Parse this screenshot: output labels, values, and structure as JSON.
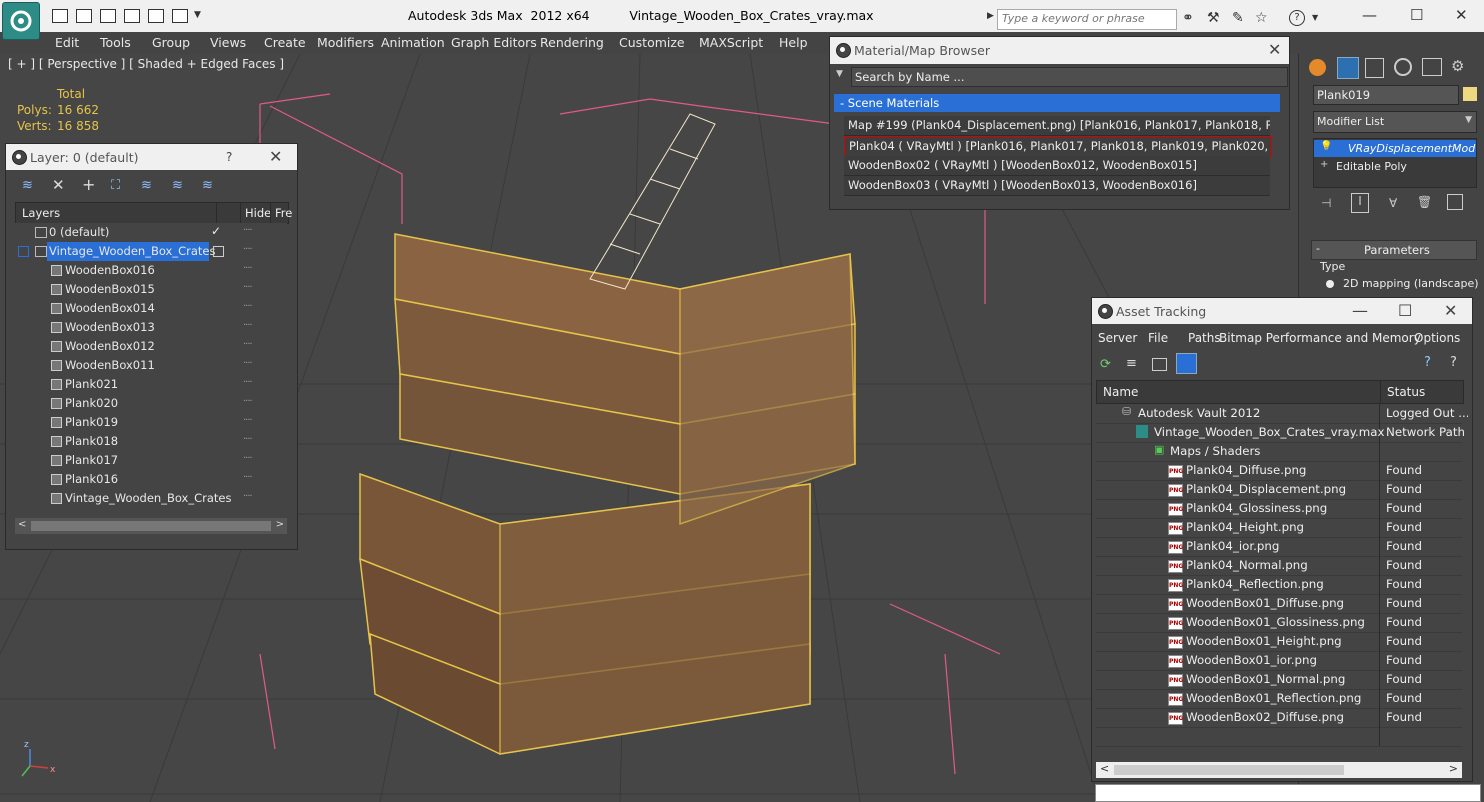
{
  "titlebar": {
    "app_title": "Autodesk 3ds Max  2012 x64",
    "file_title": "Vintage_Wooden_Box_Crates_vray.max",
    "search_placeholder": "Type a keyword or phrase"
  },
  "menu": [
    "Edit",
    "Tools",
    "Group",
    "Views",
    "Create",
    "Modifiers",
    "Animation",
    "Graph Editors",
    "Rendering",
    "Customize",
    "MAXScript",
    "Help"
  ],
  "viewport": {
    "label": "[ + ] [ Perspective ] [ Shaded + Edged Faces ]",
    "stats": {
      "total_label": "Total",
      "polys_label": "Polys:",
      "polys_value": "16 662",
      "verts_label": "Verts:",
      "verts_value": "16 858"
    }
  },
  "layer_window": {
    "title": "Layer: 0 (default)",
    "help": "?",
    "columns": {
      "layers": "Layers",
      "hide": "Hide",
      "freeze": "Fre"
    },
    "rows": [
      {
        "label": "0 (default)",
        "check": "✓"
      },
      {
        "label": "Vintage_Wooden_Box_Crates"
      },
      {
        "label": "WoodenBox016"
      },
      {
        "label": "WoodenBox015"
      },
      {
        "label": "WoodenBox014"
      },
      {
        "label": "WoodenBox013"
      },
      {
        "label": "WoodenBox012"
      },
      {
        "label": "WoodenBox011"
      },
      {
        "label": "Plank021"
      },
      {
        "label": "Plank020"
      },
      {
        "label": "Plank019"
      },
      {
        "label": "Plank018"
      },
      {
        "label": "Plank017"
      },
      {
        "label": "Plank016"
      },
      {
        "label": "Vintage_Wooden_Box_Crates"
      }
    ]
  },
  "material_browser": {
    "title": "Material/Map Browser",
    "search_placeholder": "Search by Name ...",
    "group_title": "- Scene Materials",
    "rows": [
      "Map #199 (Plank04_Displacement.png)  [Plank016, Plank017, Plank018, Plank01...",
      "Plank04  ( VRayMtl )  [Plank016, Plank017, Plank018, Plank019, Plank020, Plank0...",
      "WoodenBox02  ( VRayMtl )  [WoodenBox012, WoodenBox015]",
      "WoodenBox03  ( VRayMtl )  [WoodenBox013, WoodenBox016]"
    ]
  },
  "command_panel": {
    "object_name": "Plank019",
    "modifier_list": "Modifier List",
    "stack": [
      "VRayDisplacementMod",
      "Editable Poly"
    ],
    "rollout_title": "Parameters",
    "type_label": "Type",
    "type_option": "2D mapping (landscape)"
  },
  "asset_tracking": {
    "title": "Asset Tracking",
    "menu": [
      "Server",
      "File",
      "Paths",
      "Bitmap Performance and Memory",
      "Options"
    ],
    "columns": {
      "name": "Name",
      "status": "Status"
    },
    "rows": [
      {
        "name": "Autodesk Vault 2012",
        "status": "Logged Out ..."
      },
      {
        "name": "Vintage_Wooden_Box_Crates_vray.max",
        "status": "Network Path"
      },
      {
        "name": "Maps / Shaders",
        "status": ""
      },
      {
        "name": "Plank04_Diffuse.png",
        "status": "Found"
      },
      {
        "name": "Plank04_Displacement.png",
        "status": "Found"
      },
      {
        "name": "Plank04_Glossiness.png",
        "status": "Found"
      },
      {
        "name": "Plank04_Height.png",
        "status": "Found"
      },
      {
        "name": "Plank04_ior.png",
        "status": "Found"
      },
      {
        "name": "Plank04_Normal.png",
        "status": "Found"
      },
      {
        "name": "Plank04_Reflection.png",
        "status": "Found"
      },
      {
        "name": "WoodenBox01_Diffuse.png",
        "status": "Found"
      },
      {
        "name": "WoodenBox01_Glossiness.png",
        "status": "Found"
      },
      {
        "name": "WoodenBox01_Height.png",
        "status": "Found"
      },
      {
        "name": "WoodenBox01_ior.png",
        "status": "Found"
      },
      {
        "name": "WoodenBox01_Normal.png",
        "status": "Found"
      },
      {
        "name": "WoodenBox01_Reflection.png",
        "status": "Found"
      },
      {
        "name": "WoodenBox02_Diffuse.png",
        "status": "Found"
      }
    ]
  },
  "colors": {
    "selection": "#2a6fd6",
    "wire": "#e6c34a",
    "viewport": "#464646",
    "wood": "#7a5638"
  }
}
